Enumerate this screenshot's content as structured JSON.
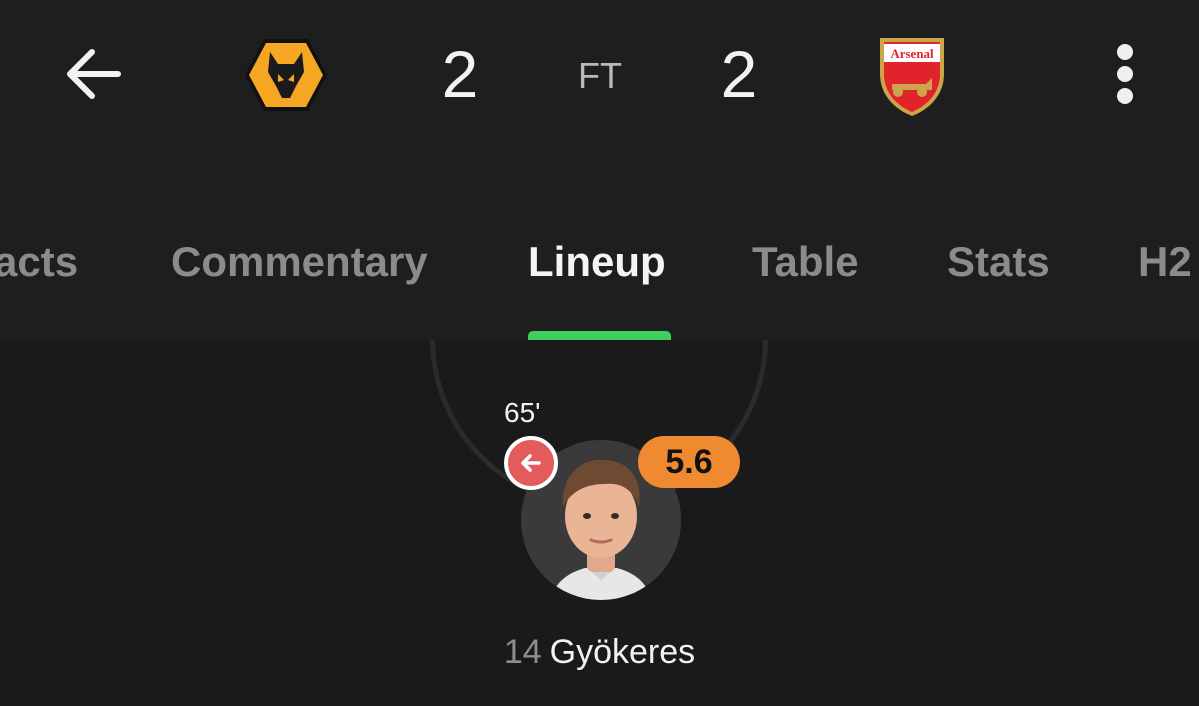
{
  "header": {
    "back_icon": "arrow-left-icon",
    "home_team": {
      "name": "Wolves",
      "logo_icon": "wolf-crest-icon",
      "color": "#f5a623"
    },
    "away_team": {
      "name": "Arsenal",
      "logo_icon": "arsenal-crest-icon",
      "logo_text": "Arsenal",
      "color": "#e1242b"
    },
    "home_score": "2",
    "away_score": "2",
    "status": "FT",
    "more_icon": "more-vertical-icon"
  },
  "tabs": [
    {
      "label": "acts",
      "active": false
    },
    {
      "label": "Commentary",
      "active": false
    },
    {
      "label": "Lineup",
      "active": true
    },
    {
      "label": "Table",
      "active": false
    },
    {
      "label": "Stats",
      "active": false
    },
    {
      "label": "H2",
      "active": false
    }
  ],
  "accent_color": "#3ecf5f",
  "lineup": {
    "player": {
      "number": "14",
      "name": "Gyökeres",
      "rating": "5.6",
      "rating_color": "#f08a30",
      "sub_minute": "65'",
      "sub_icon": "substitution-out-icon",
      "sub_icon_color": "#e35b5b"
    }
  }
}
